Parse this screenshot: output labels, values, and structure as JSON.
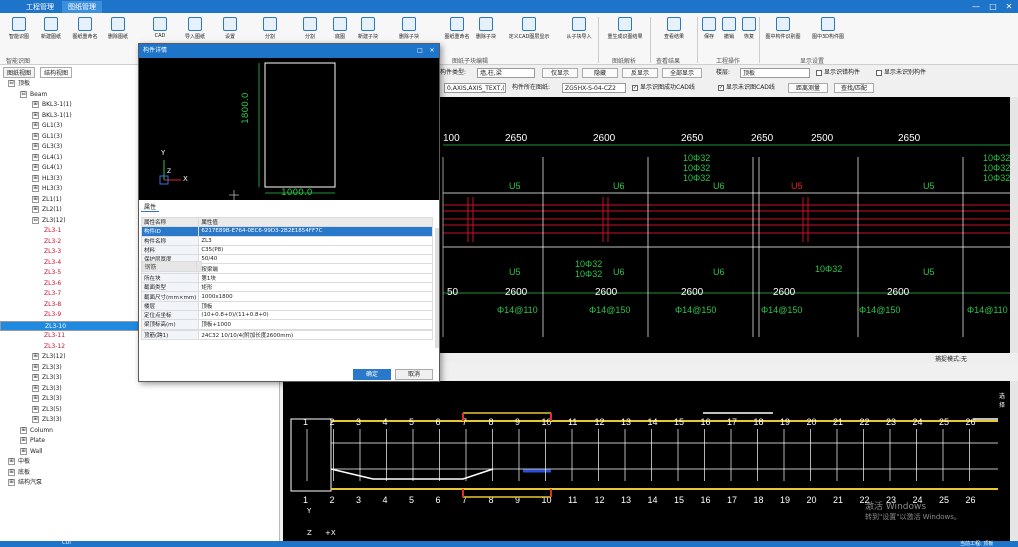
{
  "tabs": [
    "工程管理",
    "图纸管理"
  ],
  "win": {
    "min": "—",
    "max": "□",
    "close": "✕"
  },
  "ribbon": {
    "buttons": [
      "智能识图",
      "新建图纸",
      "图纸重命名",
      "删除图纸",
      "导入CAD",
      "从图纸中导入",
      "图纸设置",
      "自动分割",
      "手动分割",
      "底图设置",
      "插入图纸",
      "删除图纸",
      "导出图纸",
      "添加子块",
      "删除子块",
      "设置子块",
      "更新子块",
      "图纸重命名",
      "删除子块",
      "定义CAD图层显示",
      "从子块导入",
      "显示子块",
      "图层",
      "重生成图纸",
      "查看识图结果",
      "保存",
      "撤销",
      "恢复",
      "图中构件",
      "图中3D"
    ],
    "buttons_short": [
      "智能识图",
      "新建图纸",
      "图纸重命名",
      "删除图纸",
      "CAD",
      "导入图纸",
      "设置",
      "分割",
      "分割",
      "底图",
      "新建子块",
      "删除子块",
      "设置子块",
      "更新子块",
      "图纸重命名",
      "删除子块",
      "定义CAD图层显示",
      "从子块导入",
      "重生成识图结果",
      "查看结果",
      "保存",
      "撤销",
      "恢复",
      "图中构件识别图",
      "图中3D构件图"
    ],
    "groups": [
      "智能识图",
      "图纸子块编辑",
      "图纸解析",
      "查看结果",
      "工程操作",
      "显示设置"
    ]
  },
  "left": {
    "tabs": [
      "图纸视图",
      "结构视图"
    ],
    "tree": [
      {
        "l": 0,
        "t": "⊟",
        "x": "顶板"
      },
      {
        "l": 1,
        "t": "⊟",
        "x": "Beam"
      },
      {
        "l": 2,
        "t": "⊞",
        "x": "BKL3-1(1)"
      },
      {
        "l": 2,
        "t": "⊞",
        "x": "BKL3-1(1)"
      },
      {
        "l": 2,
        "t": "⊞",
        "x": "GL1(3)"
      },
      {
        "l": 2,
        "t": "⊞",
        "x": "GL1(3)"
      },
      {
        "l": 2,
        "t": "⊞",
        "x": "GL3(3)"
      },
      {
        "l": 2,
        "t": "⊞",
        "x": "GL4(1)"
      },
      {
        "l": 2,
        "t": "⊞",
        "x": "GL4(1)"
      },
      {
        "l": 2,
        "t": "⊞",
        "x": "HL3(3)"
      },
      {
        "l": 2,
        "t": "⊞",
        "x": "HL3(3)"
      },
      {
        "l": 2,
        "t": "⊞",
        "x": "ZL1(1)"
      },
      {
        "l": 2,
        "t": "⊞",
        "x": "ZL2(1)"
      },
      {
        "l": 2,
        "t": "⊟",
        "x": "ZL3(12)"
      },
      {
        "l": 3,
        "t": "",
        "x": "ZL3-1",
        "c": "red"
      },
      {
        "l": 3,
        "t": "",
        "x": "ZL3-2",
        "c": "red"
      },
      {
        "l": 3,
        "t": "",
        "x": "ZL3-3",
        "c": "red"
      },
      {
        "l": 3,
        "t": "",
        "x": "ZL3-4",
        "c": "red"
      },
      {
        "l": 3,
        "t": "",
        "x": "ZL3-5",
        "c": "red"
      },
      {
        "l": 3,
        "t": "",
        "x": "ZL3-6",
        "c": "red"
      },
      {
        "l": 3,
        "t": "",
        "x": "ZL3-7",
        "c": "red"
      },
      {
        "l": 3,
        "t": "",
        "x": "ZL3-8",
        "c": "red"
      },
      {
        "l": 3,
        "t": "",
        "x": "ZL3-9",
        "c": "red"
      },
      {
        "l": 3,
        "t": "",
        "x": "ZL3-10",
        "c": "sel"
      },
      {
        "l": 3,
        "t": "",
        "x": "ZL3-11",
        "c": "red"
      },
      {
        "l": 3,
        "t": "",
        "x": "ZL3-12",
        "c": "red"
      },
      {
        "l": 2,
        "t": "⊞",
        "x": "ZL3(12)"
      },
      {
        "l": 2,
        "t": "⊞",
        "x": "ZL3(3)"
      },
      {
        "l": 2,
        "t": "⊞",
        "x": "ZL3(3)"
      },
      {
        "l": 2,
        "t": "⊞",
        "x": "ZL3(3)"
      },
      {
        "l": 2,
        "t": "⊞",
        "x": "ZL3(3)"
      },
      {
        "l": 2,
        "t": "⊞",
        "x": "ZL3(5)"
      },
      {
        "l": 2,
        "t": "⊞",
        "x": "ZL3(3)"
      },
      {
        "l": 1,
        "t": "⊞",
        "x": "Column"
      },
      {
        "l": 1,
        "t": "⊞",
        "x": "Plate"
      },
      {
        "l": 1,
        "t": "⊞",
        "x": "Wall"
      },
      {
        "l": 0,
        "t": "⊞",
        "x": "中板"
      },
      {
        "l": 0,
        "t": "⊞",
        "x": "底板"
      },
      {
        "l": 0,
        "t": "⊞",
        "x": "结构汽泵"
      }
    ]
  },
  "filter": {
    "type_label": "构件类型:",
    "type_val": "墙,柱,梁",
    "only_show": "仅显示",
    "hide": "隐藏",
    "reverse": "反显示",
    "show_all": "全部显示",
    "floor_label": "楼层:",
    "floor_val": "顶板",
    "show_wrong": "显示识错构件",
    "show_unrecog": "显示未识别构件",
    "layers_val": "0,AXIS,AXIS_TEXT,(",
    "file_label": "构件所在图纸:",
    "file_val": "ZG5HX-S-04-CZ2",
    "show_cad_recog": "显示识图成功CAD线",
    "show_cad_unrecog": "显示未识图CAD线",
    "measure": "距离测量",
    "find": "查找/匹配"
  },
  "cad1": {
    "dims": [
      "100",
      "2650",
      "2600",
      "2650",
      "2650",
      "2500",
      "2650"
    ],
    "dims2": [
      "50",
      "2600",
      "2600",
      "2600",
      "2600",
      "2600"
    ],
    "rebar": [
      "Φ14@110",
      "Φ14@150",
      "Φ14@150",
      "Φ14@150",
      "Φ14@150",
      "Φ14@110"
    ],
    "labels": [
      "U5",
      "U6",
      "U5",
      "U6",
      "U6",
      "U5",
      "U5",
      "U6"
    ],
    "small": [
      "10Φ32",
      "10Φ32",
      "10Φ32",
      "10Φ32",
      "10Φ32",
      "10Φ32",
      "10Φ32",
      "10Φ32",
      "10Φ32"
    ],
    "red_label": "U5"
  },
  "status1": {
    "text": "捕捉模式:无"
  },
  "cad2": {
    "nums": [
      "1",
      "2",
      "3",
      "4",
      "5",
      "6",
      "7",
      "8",
      "9",
      "10",
      "11",
      "12",
      "13",
      "14",
      "15",
      "16",
      "17",
      "18",
      "19",
      "20",
      "21",
      "22",
      "23",
      "24",
      "25",
      "26"
    ],
    "axis_z": "Z",
    "axis_x": "+X",
    "axis_y": "Y",
    "pick": "选择",
    "watermark1": "激活 Windows",
    "watermark2": "转到\"设置\"以激活 Windows。"
  },
  "dialog": {
    "title": "构件详情",
    "max": "□",
    "close": "✕",
    "tab": "属性",
    "dim_v": "1800.0",
    "dim_h": "1000.0",
    "axis_y": "Y",
    "axis_x": "X",
    "axis_z": "Z",
    "col1": "属性名称",
    "col2": "属性值",
    "rows": [
      [
        "构件ID",
        "6217E89B-E764-0EC6-99D3-2B2E1854FF7C",
        "hl"
      ],
      [
        "构件名称",
        "ZL3",
        ""
      ],
      [
        "材料",
        "C35(P8)",
        ""
      ],
      [
        "保护层厚度",
        "50/40",
        ""
      ],
      [
        "布筋模型",
        "按梁端",
        ""
      ],
      [
        "所在块",
        "第1块",
        ""
      ],
      [
        "截面类型",
        "矩形",
        ""
      ],
      [
        "截面尺寸(mm×mm)",
        "1000x1800",
        ""
      ],
      [
        "楼层",
        "顶板",
        ""
      ],
      [
        "定位点坐标",
        "(10+0.8+0)/(11+0.8+0)",
        ""
      ],
      [
        "梁顶标高(m)",
        "顶板+1000",
        ""
      ],
      [
        "钢筋",
        "",
        "grp"
      ],
      [
        "顶筋(跨1)",
        "24C32 10/10/4(附加长度2600mm)",
        ""
      ]
    ],
    "ok": "确定",
    "cancel": "取消"
  },
  "bottom": {
    "left": "CDI",
    "right": "当前工程: 顶板"
  }
}
